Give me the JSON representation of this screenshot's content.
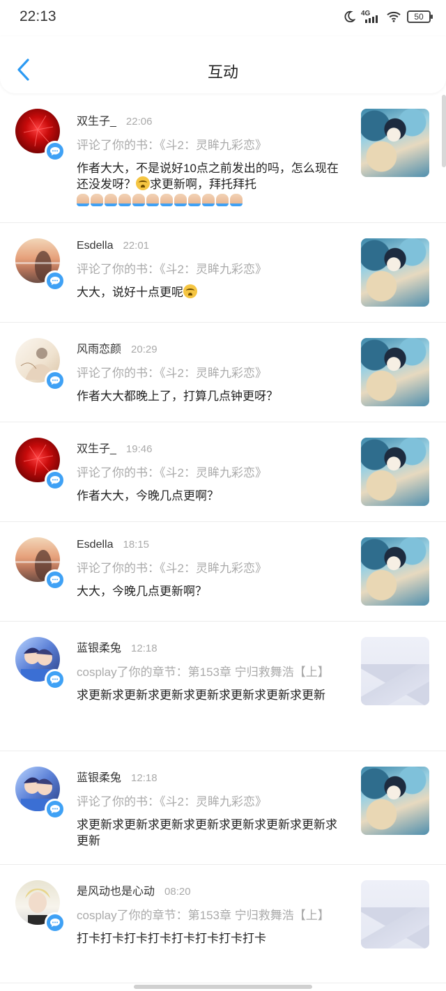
{
  "status_bar": {
    "time": "22:13",
    "network": "4G",
    "battery": "50"
  },
  "header": {
    "title": "互动"
  },
  "items": [
    {
      "user": "双生子_",
      "time": "22:06",
      "ref": "评论了你的书：《斗2：灵眸九彩恋》",
      "message": "作者大大，不是说好10点之前发出的吗，怎么现在还没发呀？",
      "message_tail": "求更新啊，拜托拜托",
      "avatar": "red-flower",
      "thumb": "cover"
    },
    {
      "user": "Esdella",
      "time": "22:01",
      "ref": "评论了你的书：《斗2：灵眸九彩恋》",
      "message": "大大，说好十点更呢",
      "avatar": "sunset-girl",
      "thumb": "cover"
    },
    {
      "user": "风雨恋颜",
      "time": "20:29",
      "ref": "评论了你的书：《斗2：灵眸九彩恋》",
      "message": "作者大大都晚上了，打算几点钟更呀？",
      "avatar": "boy-sketch",
      "thumb": "cover"
    },
    {
      "user": "双生子_",
      "time": "19:46",
      "ref": "评论了你的书：《斗2：灵眸九彩恋》",
      "message": "作者大大，今晚几点更啊？",
      "avatar": "red-flower",
      "thumb": "cover"
    },
    {
      "user": "Esdella",
      "time": "18:15",
      "ref": "评论了你的书：《斗2：灵眸九彩恋》",
      "message": "大大，今晚几点更新啊？",
      "avatar": "sunset-girl",
      "thumb": "cover"
    },
    {
      "user": "蓝银柔兔",
      "time": "12:18",
      "ref": "cosplay了你的章节：第153章 宁归救舞浩【上】",
      "message": "求更新求更新求更新求更新求更新求更新求更新",
      "avatar": "anime-duo",
      "thumb": "placeholder"
    },
    {
      "user": "蓝银柔兔",
      "time": "12:18",
      "ref": "评论了你的书：《斗2：灵眸九彩恋》",
      "message": "求更新求更新求更新求更新求更新求更新求更新求更新",
      "avatar": "anime-duo",
      "thumb": "cover"
    },
    {
      "user": "是风动也是心动",
      "time": "08:20",
      "ref": "cosplay了你的章节：第153章 宁归救舞浩【上】",
      "message": "打卡打卡打卡打卡打卡打卡打卡打卡",
      "avatar": "blond-boy",
      "thumb": "placeholder"
    }
  ]
}
